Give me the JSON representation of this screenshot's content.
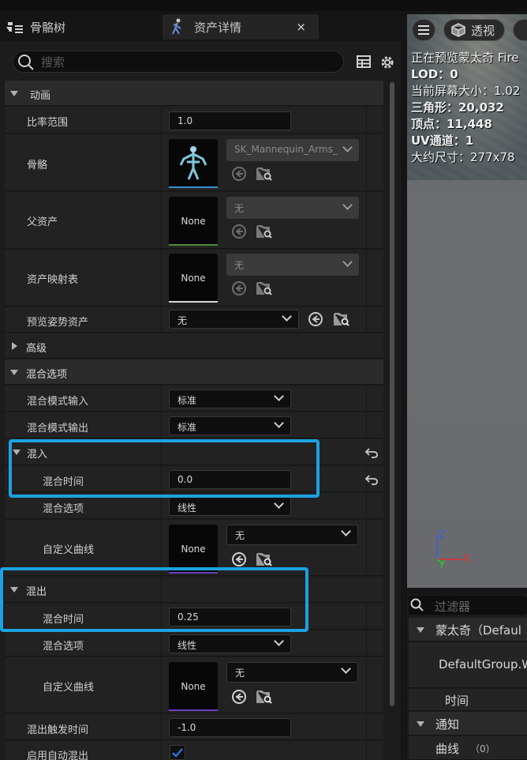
{
  "tabs": [
    {
      "label": "骨骼树",
      "icon": "skeleton-tree-icon"
    },
    {
      "label": "资产详情",
      "icon": "montage-running-figure-icon",
      "close": "×"
    }
  ],
  "search": {
    "placeholder": "搜索"
  },
  "sections": {
    "animation": "动画",
    "advanced": "高级",
    "blend_options": "混合选项",
    "blend_in": "混入",
    "blend_out": "混出"
  },
  "props": {
    "rate_scale": {
      "label": "比率范围",
      "value": "1.0"
    },
    "skeleton": {
      "label": "骨骼",
      "value": "SK_Mannequin_Arms_"
    },
    "parent_asset": {
      "label": "父资产",
      "value": "无",
      "thumb": "None"
    },
    "asset_mapping": {
      "label": "资产映射表",
      "value": "无",
      "thumb": "None"
    },
    "preview_pose": {
      "label": "预览姿势资产",
      "value": "无"
    },
    "blend_mode_in": {
      "label": "混合模式输入",
      "value": "标准"
    },
    "blend_mode_out": {
      "label": "混合模式输出",
      "value": "标准"
    },
    "blend_in_time": {
      "label": "混合时间",
      "value": "0.0"
    },
    "blend_in_option": {
      "label": "混合选项",
      "value": "线性"
    },
    "blend_in_curve": {
      "label": "自定义曲线",
      "value": "无",
      "thumb": "None"
    },
    "blend_out_time": {
      "label": "混合时间",
      "value": "0.25"
    },
    "blend_out_option": {
      "label": "混合选项",
      "value": "线性"
    },
    "blend_out_curve": {
      "label": "自定义曲线",
      "value": "无",
      "thumb": "None"
    },
    "blend_out_trigger": {
      "label": "混出触发时间",
      "value": "-1.0"
    },
    "auto_blend_out": {
      "label": "启用自动混出",
      "checked": true
    }
  },
  "viewport": {
    "perspective": "透视",
    "info": [
      "正在预览蒙太奇 Fire",
      "LOD：0",
      "当前屏幕大小：1.02",
      "三角形：20,032",
      "顶点：11,448",
      "UV通道：1",
      "大约尺寸：277x78"
    ],
    "axes": {
      "z": "Z",
      "y": "Y",
      "x": "X"
    }
  },
  "montage_panel": {
    "filter_placeholder": "过滤器",
    "montage_row": "蒙太奇（Defaul",
    "group": "DefaultGroup.W",
    "time": "时间",
    "notify": "通知",
    "curves": "曲线",
    "curves_count": "（0）"
  },
  "colors": {
    "highlight": "#1ba2e0",
    "skeleton_bar": "#3b8fd0",
    "parent_bar": "#4f8a3a",
    "mapping_bar": "#d8d8d8",
    "curve_bar": "#6a3fc0",
    "checkbox": "#2a6fd4"
  }
}
